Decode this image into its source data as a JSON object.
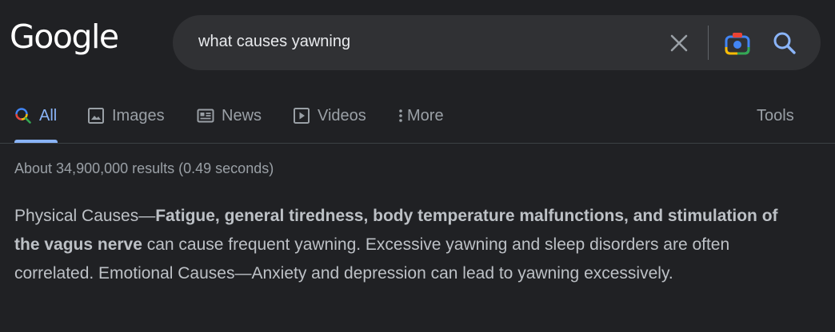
{
  "logo": {
    "text": "Google"
  },
  "search": {
    "query": "what causes yawning",
    "icons": [
      "close-icon",
      "google-lens-icon",
      "search-icon"
    ]
  },
  "tabs": [
    {
      "label": "All",
      "icon": "search-icon",
      "active": true
    },
    {
      "label": "Images",
      "icon": "image-icon",
      "active": false
    },
    {
      "label": "News",
      "icon": "news-icon",
      "active": false
    },
    {
      "label": "Videos",
      "icon": "video-play-icon",
      "active": false
    },
    {
      "label": "More",
      "icon": "more-vertical-icon",
      "active": false
    }
  ],
  "tools_label": "Tools",
  "result_stats": "About 34,900,000 results (0.49 seconds)",
  "snippet": {
    "prefix": "Physical Causes—",
    "bold": "Fatigue, general tiredness, body temperature malfunctions, and stimulation of the vagus nerve",
    "suffix": " can cause frequent yawning. Excessive yawning and sleep disorders are often correlated. Emotional Causes—Anxiety and depression can lead to yawning excessively."
  },
  "colors": {
    "background": "#202124",
    "search_box": "#303134",
    "active_tab": "#8ab4f8",
    "muted_text": "#9aa0a6",
    "body_text": "#bdc1c6"
  }
}
